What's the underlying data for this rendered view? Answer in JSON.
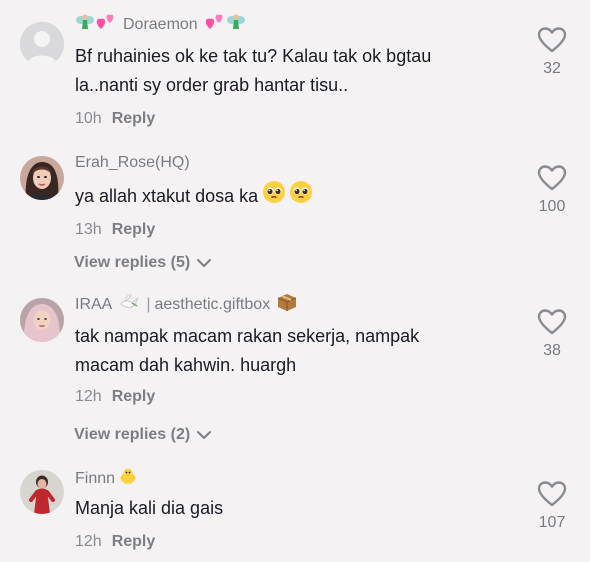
{
  "comments": [
    {
      "username": "Doraemon",
      "text_line1": "Bf ruhainies ok ke tak tu? Kalau tak ok bgtau",
      "text_line2": "la..nanti sy order grab hantar tisu..",
      "time": "10h",
      "reply_label": "Reply",
      "likes": "32",
      "avatar": "default-avatar-icon"
    },
    {
      "username": "Erah_Rose(HQ)",
      "text_line1": "ya allah xtakut dosa ka",
      "time": "13h",
      "reply_label": "Reply",
      "likes": "100",
      "view_replies": "View replies (5)",
      "avatar": "user-photo"
    },
    {
      "username": "IRAA",
      "username_extra": "aesthetic.giftbox",
      "text_line1": "tak nampak macam rakan sekerja, nampak",
      "text_line2": "macam dah kahwin. huargh",
      "time": "12h",
      "reply_label": "Reply",
      "likes": "38",
      "view_replies": "View replies (2)",
      "avatar": "user-photo"
    },
    {
      "username": "Finnn",
      "text_line1": "Manja kali dia gais",
      "time": "12h",
      "reply_label": "Reply",
      "likes": "107",
      "avatar": "user-photo"
    }
  ],
  "colors": {
    "background": "#f4f2f3",
    "text": "#1a1b24",
    "muted": "#7a7b82",
    "heart_outline": "#8a8b91"
  }
}
